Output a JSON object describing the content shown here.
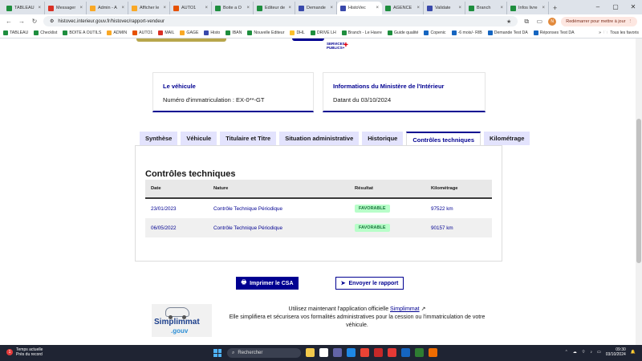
{
  "browser": {
    "tabs": [
      {
        "label": "TABLEAU",
        "color": "#1e8e3e",
        "active": false
      },
      {
        "label": "Messager",
        "color": "#d93025",
        "active": false
      },
      {
        "label": "Admin - A",
        "color": "#f9a825",
        "active": false
      },
      {
        "label": "Afficher le",
        "color": "#f9a825",
        "active": false
      },
      {
        "label": "AUTO1",
        "color": "#e65100",
        "active": false
      },
      {
        "label": "Boite a O",
        "color": "#1e8e3e",
        "active": false
      },
      {
        "label": "Editeur de",
        "color": "#1e8e3e",
        "active": false
      },
      {
        "label": "Demande",
        "color": "#3949ab",
        "active": false
      },
      {
        "label": "HistoVec",
        "color": "#3949ab",
        "active": true
      },
      {
        "label": "AGENCE",
        "color": "#1e8e3e",
        "active": false
      },
      {
        "label": "Validate",
        "color": "#3949ab",
        "active": false
      },
      {
        "label": "Branch",
        "color": "#1e8e3e",
        "active": false
      },
      {
        "label": "Infos livre",
        "color": "#1e8e3e",
        "active": false
      }
    ],
    "new_tab": "+",
    "url": "histovec.interieur.gouv.fr/histovec/rapport-vendeur",
    "restart_label": "Redémarrer pour mettre à jour",
    "avatar_letter": "N",
    "bookmarks": [
      {
        "label": "TABLEAU",
        "color": "#1e8e3e"
      },
      {
        "label": "Checklist",
        "color": "#1e8e3e"
      },
      {
        "label": "BOITE A OUTILS",
        "color": "#1e8e3e"
      },
      {
        "label": "ADMIN",
        "color": "#f9a825"
      },
      {
        "label": "AUTO1",
        "color": "#e65100"
      },
      {
        "label": "MAIL",
        "color": "#d93025"
      },
      {
        "label": "GAGE",
        "color": "#f9a825"
      },
      {
        "label": "Histo",
        "color": "#3949ab"
      },
      {
        "label": "IBAN",
        "color": "#1e8e3e"
      },
      {
        "label": "Nouvelle Editeur",
        "color": "#1e8e3e"
      },
      {
        "label": "DHL",
        "color": "#fbc02d"
      },
      {
        "label": "DRIVE LH",
        "color": "#1e8e3e"
      },
      {
        "label": "Branch - Le Havre",
        "color": "#1e8e3e"
      },
      {
        "label": "Guide qualité",
        "color": "#1e8e3e"
      },
      {
        "label": "Copenic",
        "color": "#1565c0"
      },
      {
        "label": "-6 mois/- RIB",
        "color": "#1565c0"
      },
      {
        "label": "Demande Test DA",
        "color": "#1565c0"
      },
      {
        "label": "Réponses Test DA",
        "color": "#1565c0"
      }
    ],
    "bookmarks_more": "»",
    "all_favorites": "Tous les favoris"
  },
  "header": {
    "service_public_label": "SERVICES PUBLICS+"
  },
  "cards": {
    "vehicle": {
      "title": "Le véhicule",
      "subtitle": "Numéro d'immatriculation : EX-0**-GT"
    },
    "ministry": {
      "title": "Informations du Ministère de l'Intérieur",
      "subtitle": "Datant du 03/10/2024"
    }
  },
  "tabs": [
    {
      "label": "Synthèse",
      "active": false
    },
    {
      "label": "Véhicule",
      "active": false
    },
    {
      "label": "Titulaire et Titre",
      "active": false
    },
    {
      "label": "Situation administrative",
      "active": false
    },
    {
      "label": "Historique",
      "active": false
    },
    {
      "label": "Contrôles techniques",
      "active": true
    },
    {
      "label": "Kilométrage",
      "active": false
    }
  ],
  "controles": {
    "heading": "Contrôles techniques",
    "columns": [
      "Date",
      "Nature",
      "Résultat",
      "Kilométrage"
    ],
    "rows": [
      {
        "date": "23/01/2023",
        "nature": "Contrôle Technique Périodique",
        "result": "FAVORABLE",
        "km": "97522 km"
      },
      {
        "date": "06/05/2022",
        "nature": "Contrôle Technique Périodique",
        "result": "FAVORABLE",
        "km": "90157 km"
      }
    ]
  },
  "actions": {
    "print": "Imprimer le CSA",
    "send": "Envoyer le rapport"
  },
  "promo": {
    "logo_name": "Simplimmat",
    "logo_suffix": ".gouv",
    "line1_prefix": "Utilisez maintenant l'application officielle ",
    "line1_link": "Simplimmat",
    "line2": "Elle simplifiera et sécurisera vos formalités administratives pour la cession ou l'immatriculation de votre véhicule."
  },
  "taskbar": {
    "weather_temp": "Temps actuelle",
    "weather_desc": "Près du record",
    "weather_badge": "1",
    "search_placeholder": "Rechercher",
    "time": "09:30",
    "date": "03/10/2024",
    "app_colors": [
      "#f2c94c",
      "#ffffff",
      "#6264a7",
      "#1e88e5",
      "#ea4335",
      "#c62828",
      "#e53935",
      "#1565c0",
      "#2e7d32",
      "#ef6c00"
    ]
  }
}
